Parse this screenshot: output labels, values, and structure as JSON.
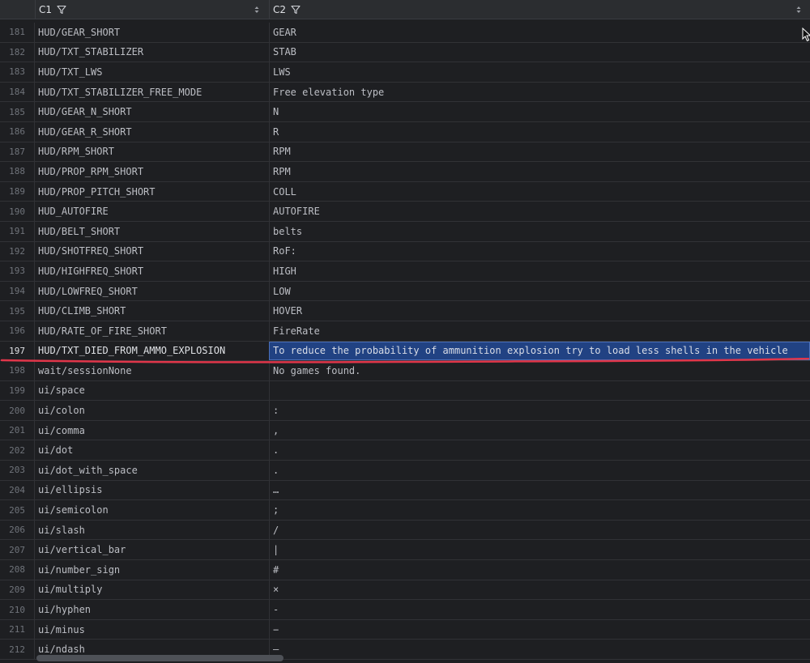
{
  "header": {
    "col1": "C1",
    "col2": "C2"
  },
  "rows": [
    {
      "num": "181",
      "c1": "HUD/GEAR_SHORT",
      "c2": "GEAR"
    },
    {
      "num": "182",
      "c1": "HUD/TXT_STABILIZER",
      "c2": "STAB"
    },
    {
      "num": "183",
      "c1": "HUD/TXT_LWS",
      "c2": "LWS"
    },
    {
      "num": "184",
      "c1": "HUD/TXT_STABILIZER_FREE_MODE",
      "c2": "Free elevation type"
    },
    {
      "num": "185",
      "c1": "HUD/GEAR_N_SHORT",
      "c2": "N"
    },
    {
      "num": "186",
      "c1": "HUD/GEAR_R_SHORT",
      "c2": "R"
    },
    {
      "num": "187",
      "c1": "HUD/RPM_SHORT",
      "c2": "RPM"
    },
    {
      "num": "188",
      "c1": "HUD/PROP_RPM_SHORT",
      "c2": "RPM"
    },
    {
      "num": "189",
      "c1": "HUD/PROP_PITCH_SHORT",
      "c2": "COLL"
    },
    {
      "num": "190",
      "c1": "HUD_AUTOFIRE",
      "c2": "AUTOFIRE"
    },
    {
      "num": "191",
      "c1": "HUD/BELT_SHORT",
      "c2": "belts"
    },
    {
      "num": "192",
      "c1": "HUD/SHOTFREQ_SHORT",
      "c2": "RoF:"
    },
    {
      "num": "193",
      "c1": "HUD/HIGHFREQ_SHORT",
      "c2": "HIGH"
    },
    {
      "num": "194",
      "c1": "HUD/LOWFREQ_SHORT",
      "c2": "LOW"
    },
    {
      "num": "195",
      "c1": "HUD/CLIMB_SHORT",
      "c2": "HOVER"
    },
    {
      "num": "196",
      "c1": "HUD/RATE_OF_FIRE_SHORT",
      "c2": "FireRate"
    },
    {
      "num": "197",
      "c1": "HUD/TXT_DIED_FROM_AMMO_EXPLOSION",
      "c2": "To reduce the probability of ammunition explosion try to load less shells in the vehicle",
      "selected": true
    },
    {
      "num": "198",
      "c1": "wait/sessionNone",
      "c2": "No games found."
    },
    {
      "num": "199",
      "c1": "ui/space",
      "c2": ""
    },
    {
      "num": "200",
      "c1": "ui/colon",
      "c2": ":"
    },
    {
      "num": "201",
      "c1": "ui/comma",
      "c2": ","
    },
    {
      "num": "202",
      "c1": "ui/dot",
      "c2": "."
    },
    {
      "num": "203",
      "c1": "ui/dot_with_space",
      "c2": "."
    },
    {
      "num": "204",
      "c1": "ui/ellipsis",
      "c2": "…"
    },
    {
      "num": "205",
      "c1": "ui/semicolon",
      "c2": ";"
    },
    {
      "num": "206",
      "c1": "ui/slash",
      "c2": " /"
    },
    {
      "num": "207",
      "c1": "ui/vertical_bar",
      "c2": " |"
    },
    {
      "num": "208",
      "c1": "ui/number_sign",
      "c2": "#"
    },
    {
      "num": "209",
      "c1": "ui/multiply",
      "c2": "×"
    },
    {
      "num": "210",
      "c1": "ui/hyphen",
      "c2": "-"
    },
    {
      "num": "211",
      "c1": "ui/minus",
      "c2": "−"
    },
    {
      "num": "212",
      "c1": "ui/ndash",
      "c2": "–"
    }
  ],
  "icons": {
    "filter": "filter-icon",
    "sort": "sort-icon"
  },
  "colors": {
    "background": "#1e1f22",
    "header": "#2b2d30",
    "selection": "#214283",
    "underline": "#e0364a"
  }
}
